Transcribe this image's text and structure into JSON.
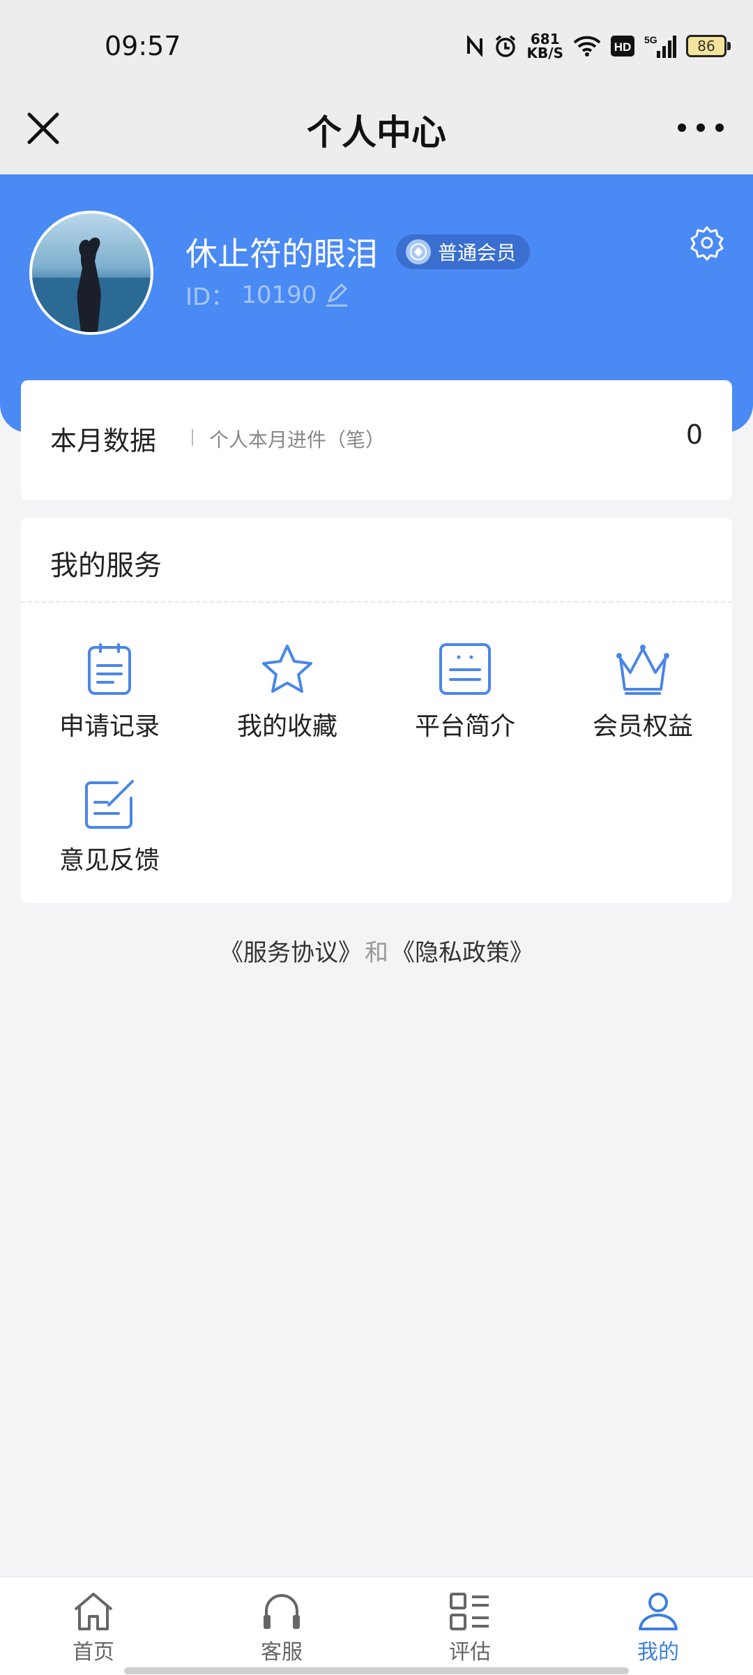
{
  "status_bar": {
    "time": "09:57",
    "net_speed_value": "681",
    "net_speed_unit": "KB/S",
    "hd_label": "HD",
    "network_label": "5G",
    "battery": "86",
    "icons": [
      "nfc-icon",
      "alarm-icon",
      "wifi-icon",
      "hd-icon",
      "signal-icon",
      "battery-icon"
    ]
  },
  "nav": {
    "title": "个人中心",
    "icons": [
      "close-icon",
      "more-icon"
    ]
  },
  "profile": {
    "username": "休止符的眼泪",
    "badge": "普通会员",
    "id_label": "ID：",
    "id_value": "10190",
    "icons": [
      "avatar",
      "member-icon",
      "edit-icon",
      "gear-icon"
    ]
  },
  "month_data": {
    "title": "本月数据",
    "subtitle": "个人本月进件（笔）",
    "value": "0"
  },
  "services": {
    "title": "我的服务",
    "items": [
      {
        "label": "申请记录",
        "icon": "clipboard-icon"
      },
      {
        "label": "我的收藏",
        "icon": "star-icon"
      },
      {
        "label": "平台简介",
        "icon": "document-icon"
      },
      {
        "label": "会员权益",
        "icon": "crown-icon"
      },
      {
        "label": "意见反馈",
        "icon": "feedback-edit-icon"
      }
    ]
  },
  "agreement": {
    "service_link": "《服务协议》",
    "and_text": "和",
    "privacy_link": "《隐私政策》"
  },
  "tabbar": {
    "tabs": [
      {
        "label": "首页",
        "icon": "home-icon"
      },
      {
        "label": "客服",
        "icon": "headset-icon"
      },
      {
        "label": "评估",
        "icon": "list-grid-icon"
      },
      {
        "label": "我的",
        "icon": "person-icon",
        "active": true
      }
    ]
  },
  "colors": {
    "brand_blue": "#4a8af4",
    "icon_blue": "#4a86e8",
    "active_tab": "#3b7fe0"
  }
}
